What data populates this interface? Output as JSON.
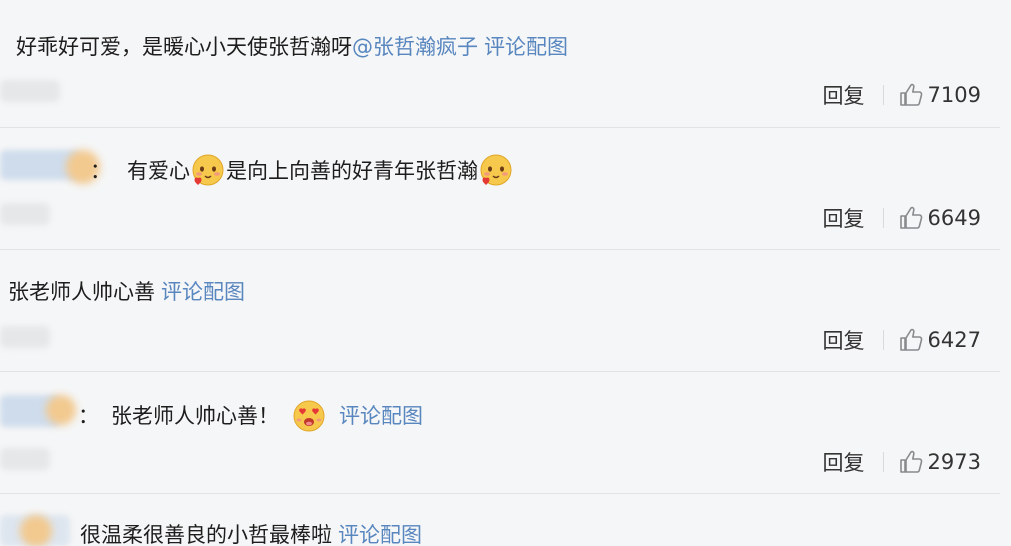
{
  "colors": {
    "link": "#5886bf",
    "text": "#1d1d1d",
    "background": "#f5f6f7",
    "divider": "#e2e3e5"
  },
  "comments": [
    {
      "text": "好乖好可爱，是暖心小天使张哲瀚呀",
      "mention": "@张哲瀚疯子",
      "photo_link": "评论配图",
      "reply_label": "回复",
      "likes": "7109"
    },
    {
      "colon": "：",
      "text_part1": "有爱心",
      "text_part2": "是向上向善的好青年张哲瀚",
      "emoji_icon": "blush-heart-emoji",
      "reply_label": "回复",
      "likes": "6649"
    },
    {
      "text": "张老师人帅心善",
      "photo_link": "评论配图",
      "reply_label": "回复",
      "likes": "6427"
    },
    {
      "colon": "：",
      "text": "张老师人帅心善！",
      "emoji_icon": "heart-eyes-emoji",
      "photo_link": "评论配图",
      "reply_label": "回复",
      "likes": "2973"
    },
    {
      "text": "很温柔很善良的小哲最棒啦",
      "photo_link": "评论配图"
    }
  ]
}
